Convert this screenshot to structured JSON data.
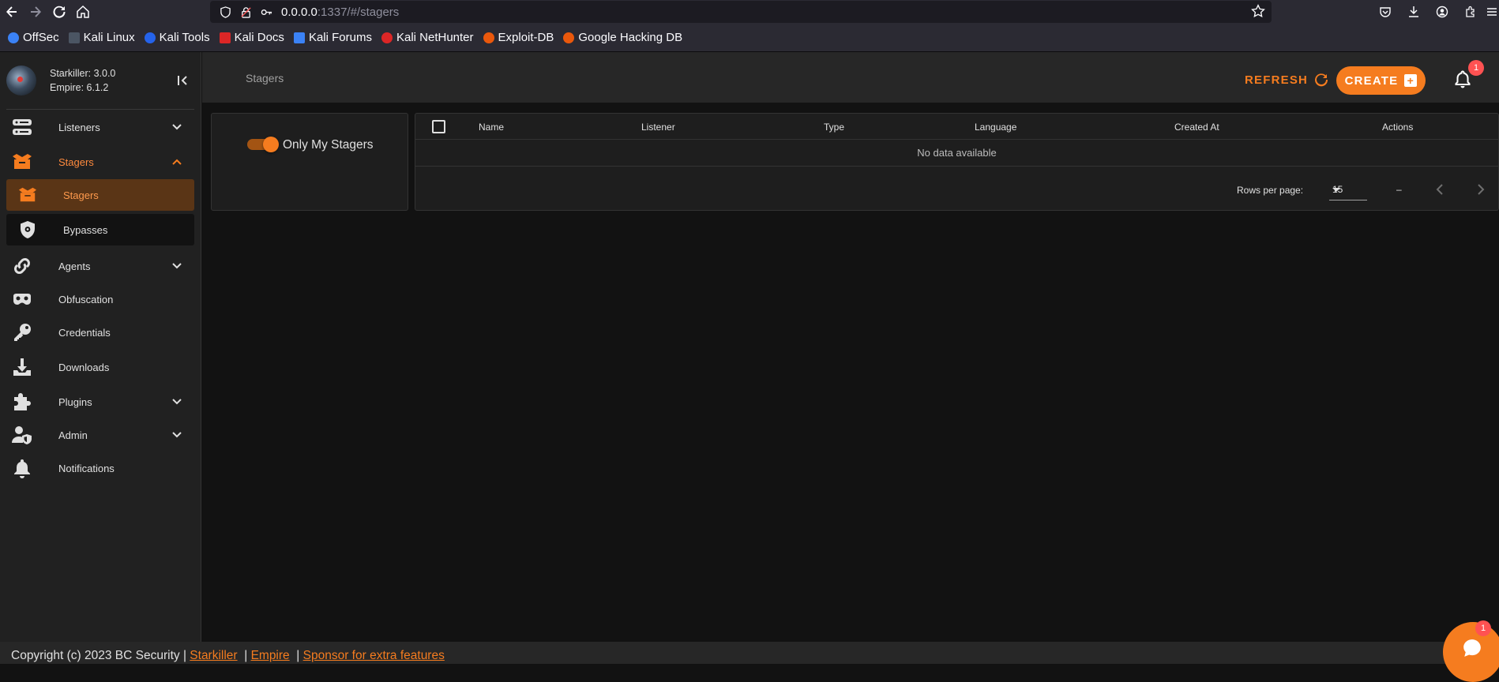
{
  "browser": {
    "url_host": "0.0.0.0",
    "url_rest": ":1337/#/stagers",
    "bookmarks": [
      {
        "label": "OffSec",
        "color": "#3b82f6"
      },
      {
        "label": "Kali Linux",
        "color": "#1f2937"
      },
      {
        "label": "Kali Tools",
        "color": "#2563eb"
      },
      {
        "label": "Kali Docs",
        "color": "#dc2626"
      },
      {
        "label": "Kali Forums",
        "color": "#3b82f6"
      },
      {
        "label": "Kali NetHunter",
        "color": "#dc2626"
      },
      {
        "label": "Exploit-DB",
        "color": "#ea580c"
      },
      {
        "label": "Google Hacking DB",
        "color": "#ea580c"
      }
    ]
  },
  "brand": {
    "starkiller": "Starkiller: 3.0.0",
    "empire": "Empire: 6.1.2"
  },
  "sidebar": {
    "listeners": "Listeners",
    "stagers": "Stagers",
    "stagers_sub": "Stagers",
    "bypasses": "Bypasses",
    "agents": "Agents",
    "obfuscation": "Obfuscation",
    "credentials": "Credentials",
    "downloads": "Downloads",
    "plugins": "Plugins",
    "admin": "Admin",
    "notifications": "Notifications"
  },
  "header": {
    "title": "Stagers",
    "refresh": "REFRESH",
    "create": "CREATE",
    "notification_count": "1"
  },
  "filter": {
    "only_mine_label": "Only My Stagers",
    "only_mine_enabled": true
  },
  "table": {
    "columns": [
      "Name",
      "Listener",
      "Type",
      "Language",
      "Created At",
      "Actions"
    ],
    "empty_text": "No data available",
    "rows_per_page_label": "Rows per page:",
    "rows_per_page": "15",
    "range": "–"
  },
  "footer": {
    "copyright": "Copyright (c) 2023 BC Security",
    "sep": "|",
    "link_starkiller": "Starkiller",
    "link_empire": "Empire",
    "link_sponsor": "Sponsor for extra features",
    "chat_badge": "1"
  },
  "colors": {
    "accent": "#f57c1f",
    "badge": "#ff5252"
  }
}
